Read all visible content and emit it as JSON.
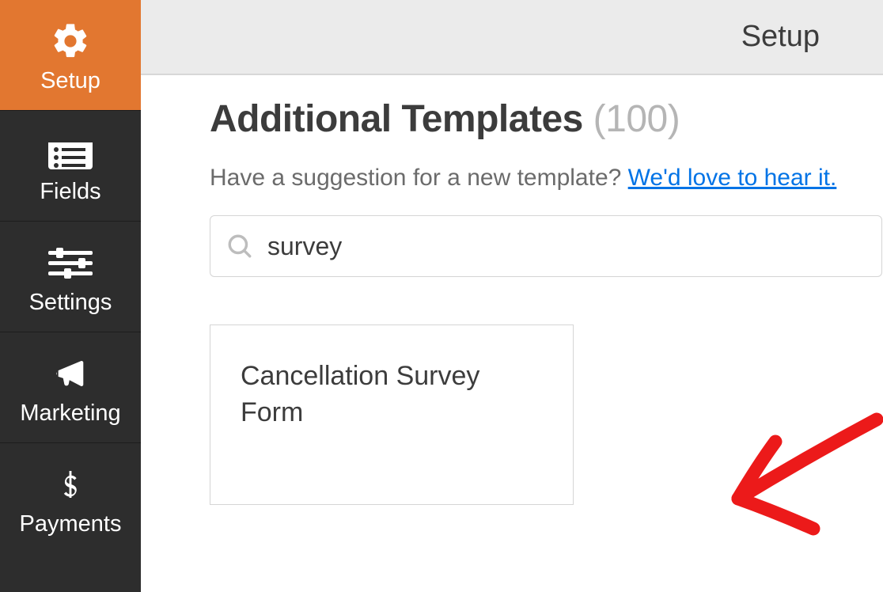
{
  "topbar": {
    "title": "Setup"
  },
  "sidebar": {
    "items": [
      {
        "label": "Setup"
      },
      {
        "label": "Fields"
      },
      {
        "label": "Settings"
      },
      {
        "label": "Marketing"
      },
      {
        "label": "Payments"
      }
    ]
  },
  "main": {
    "heading_text": "Additional Templates",
    "heading_count": "(100)",
    "suggestion_text": "Have a suggestion for a new template? ",
    "suggestion_link": "We'd love to hear it.",
    "search_value": "survey",
    "template_card_title": "Cancellation Survey Form"
  }
}
